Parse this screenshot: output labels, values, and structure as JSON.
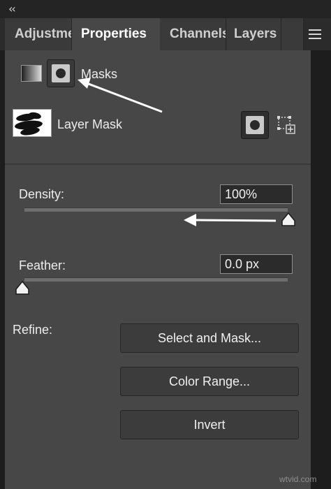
{
  "tabs": [
    {
      "label": "Adjustments",
      "active": false
    },
    {
      "label": "Properties",
      "active": true
    },
    {
      "label": "Channels",
      "active": false
    },
    {
      "label": "Layers",
      "active": false
    }
  ],
  "icons": {
    "collapse": "double-chevron-left-icon",
    "menu": "hamburger-menu-icon",
    "pixel_mask": "pixel-mask-icon",
    "vector_mask": "vector-mask-icon",
    "add_mask": "add-vector-mask-icon",
    "transform": "transform-selection-icon"
  },
  "masks": {
    "label": "Masks"
  },
  "layer_mask": {
    "label": "Layer Mask"
  },
  "density": {
    "label": "Density:",
    "value": "100%",
    "slider_fraction": 1.0
  },
  "feather": {
    "label": "Feather:",
    "value": "0.0 px",
    "slider_fraction": 0.0
  },
  "refine": {
    "label": "Refine:"
  },
  "buttons": {
    "select_and_mask": "Select and Mask...",
    "color_range": "Color Range...",
    "invert": "Invert"
  },
  "watermark": "wtvid.com",
  "colors": {
    "panel_bg": "#474747",
    "tab_active_bg": "#474747",
    "tab_bg": "#3a3a3a",
    "annotation_arrow": "#ffffff"
  }
}
